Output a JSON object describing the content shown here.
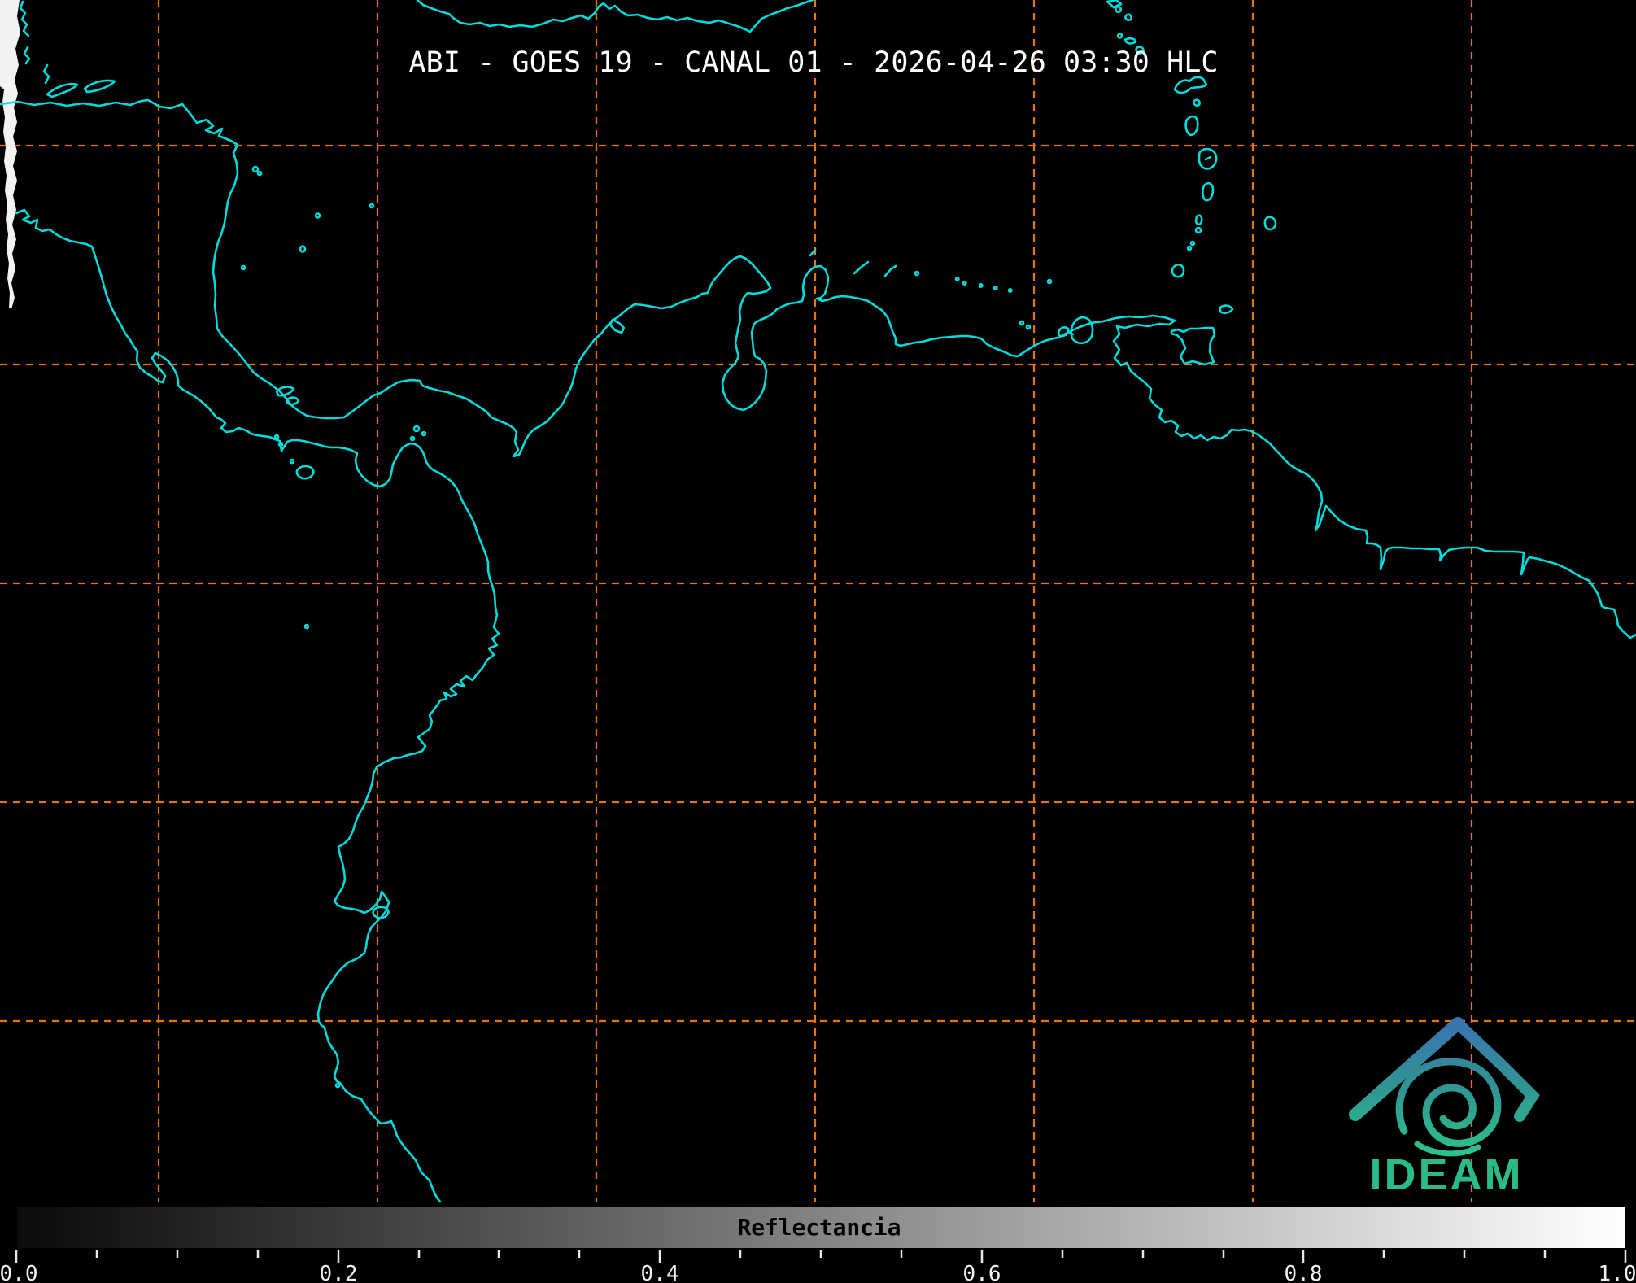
{
  "header": {
    "title": "ABI - GOES 19 - CANAL 01 - 2026-04-26 03:30 HLC"
  },
  "map": {
    "description": "GOES-19 ABI channel 01 visible satellite scene, nighttime (black), cyan coastlines over Central America, Caribbean and northern South America, orange dashed graticule"
  },
  "colorbar": {
    "label": "Reflectancia",
    "ticks": [
      "0.0",
      "0.2",
      "0.4",
      "0.6",
      "0.8",
      "1.0"
    ],
    "min": 0.0,
    "max": 1.0,
    "gradient_start": "#000000",
    "gradient_end": "#ffffff"
  },
  "logo": {
    "name": "IDEAM"
  },
  "colors": {
    "background": "#000000",
    "coastline": "#00dcdc",
    "graticule": "#e8740e",
    "title_text": "#ffffff",
    "tick_text": "#f2f2f2",
    "cloud_edge": "#f2f2f2",
    "logo_blue": "#3b72b5",
    "logo_green": "#2cc08c",
    "logo_text_green": "#2abb88"
  }
}
